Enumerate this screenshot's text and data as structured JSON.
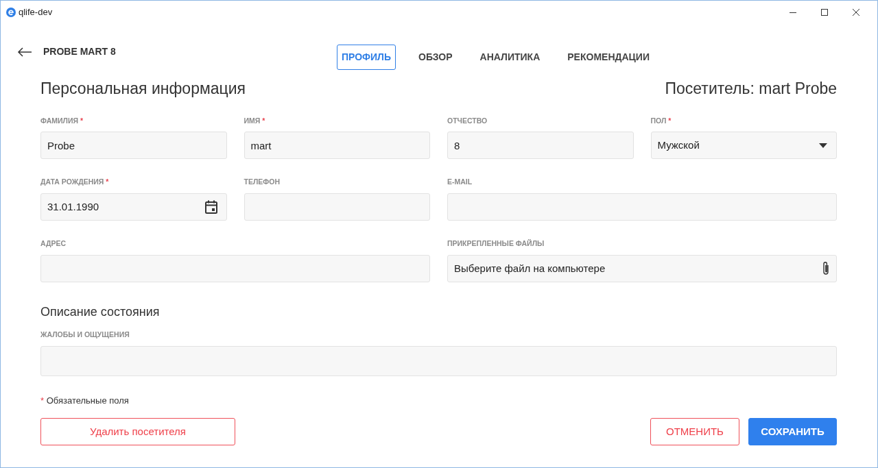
{
  "window": {
    "title": "qlife-dev"
  },
  "header": {
    "title": "PROBE MART 8"
  },
  "tabs": [
    {
      "label": "ПРОФИЛЬ",
      "selected": true
    },
    {
      "label": "ОБЗОР",
      "selected": false
    },
    {
      "label": "АНАЛИТИКА",
      "selected": false
    },
    {
      "label": "РЕКОМЕНДАЦИИ",
      "selected": false
    }
  ],
  "visitor_title": "Посетитель: mart Probe",
  "sections": [
    {
      "title": "Персональная информация",
      "fields": [
        {
          "kind": "text",
          "label": "ФАМИЛИЯ",
          "required_mark": "*",
          "value": "Probe"
        },
        {
          "kind": "text",
          "label": "ИМЯ",
          "required_mark": "*",
          "value": "mart"
        },
        {
          "kind": "text",
          "label": "ОТЧЕСТВО",
          "value": "8"
        },
        {
          "kind": "select",
          "label": "ПОЛ",
          "required_mark": "*",
          "value": "Мужской"
        },
        {
          "kind": "date",
          "label": "ДАТА РОЖДЕНИЯ",
          "required_mark": "*",
          "value": "31.01.1990"
        },
        {
          "kind": "text",
          "label": "ТЕЛЕФОН"
        },
        {
          "kind": "text",
          "label": "E-MAIL"
        },
        {
          "kind": "text",
          "label": "АДРЕС"
        },
        {
          "kind": "file",
          "label": "ПРИКРЕПЛЕННЫЕ ФАЙЛЫ",
          "placeholder": "Выберите файл на компьютере"
        }
      ]
    },
    {
      "title": "Описание состояния",
      "fields": [
        {
          "kind": "textarea",
          "label": "ЖАЛОБЫ И ОЩУЩЕНИЯ"
        }
      ]
    }
  ],
  "required_note": {
    "mark": "*",
    "text": "Обязательные поля"
  },
  "buttons": [
    {
      "kind": "danger",
      "label": "Удалить посетителя"
    },
    {
      "kind": "outline",
      "label": "ОТМЕНИТЬ"
    },
    {
      "kind": "primary",
      "label": "СОХРАНИТЬ"
    }
  ]
}
